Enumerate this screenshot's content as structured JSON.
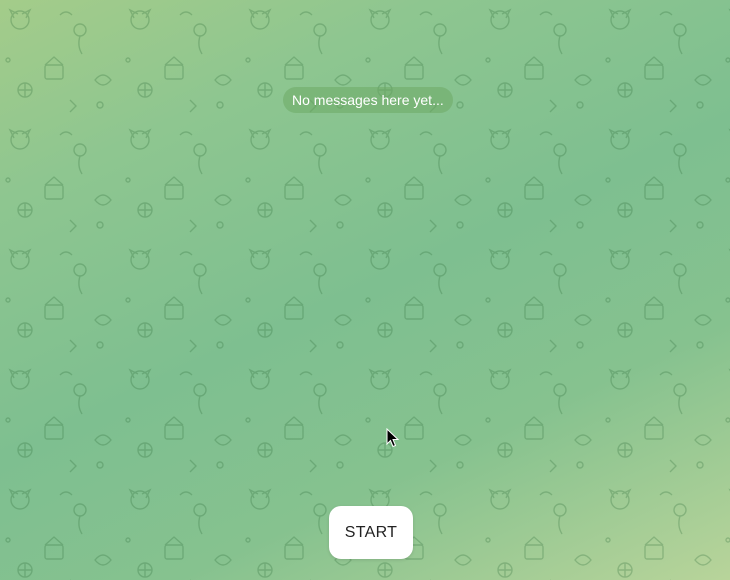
{
  "chat": {
    "empty_message": "No messages here yet...",
    "start_button_label": "START"
  },
  "colors": {
    "wallpaper_gradient": [
      "#a4cc8a",
      "#7ebf90",
      "#b8d49a"
    ],
    "notice_bg": "#6eaa64",
    "button_bg": "#ffffff"
  },
  "icons": {
    "cursor": "mouse-pointer-icon",
    "wallpaper_pattern": "doodle-pattern"
  }
}
